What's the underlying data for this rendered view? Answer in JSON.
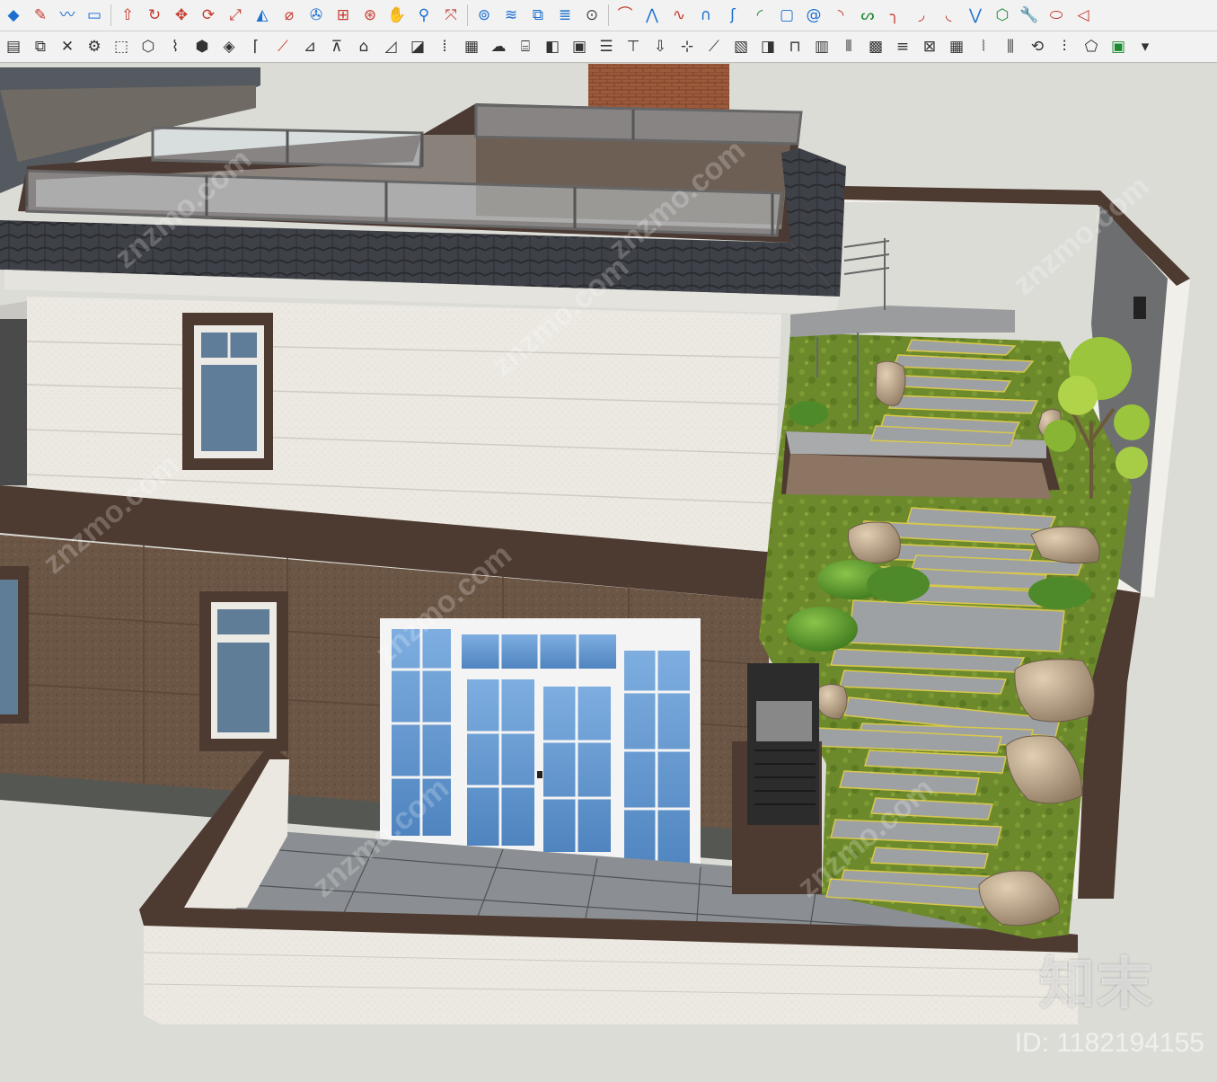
{
  "toolbar_row1": [
    {
      "icon": "eraser-icon",
      "glyph": "◆",
      "color": "#1a6fd1"
    },
    {
      "icon": "pencil-line-icon",
      "glyph": "✎",
      "color": "#c43a2e"
    },
    {
      "icon": "freehand-icon",
      "glyph": "〰",
      "color": "#1a6fd1"
    },
    {
      "icon": "rectangle-icon",
      "glyph": "▭",
      "color": "#1a6fd1"
    },
    {
      "icon": "push-pull-icon",
      "glyph": "⇧",
      "color": "#c43a2e"
    },
    {
      "icon": "follow-me-icon",
      "glyph": "↻",
      "color": "#c43a2e"
    },
    {
      "icon": "move-icon",
      "glyph": "✥",
      "color": "#c43a2e"
    },
    {
      "icon": "rotate-icon",
      "glyph": "⟳",
      "color": "#c43a2e"
    },
    {
      "icon": "scale-icon",
      "glyph": "⤢",
      "color": "#c43a2e"
    },
    {
      "icon": "offset-icon",
      "glyph": "◭",
      "color": "#1a6fd1"
    },
    {
      "icon": "tape-measure-icon",
      "glyph": "⌀",
      "color": "#c43a2e"
    },
    {
      "icon": "paint-bucket-icon",
      "glyph": "✇",
      "color": "#1a6fd1"
    },
    {
      "icon": "section-plane-icon",
      "glyph": "⊞",
      "color": "#c43a2e"
    },
    {
      "icon": "orbit-icon",
      "glyph": "⊛",
      "color": "#c43a2e"
    },
    {
      "icon": "pan-icon",
      "glyph": "✋",
      "color": "#c43a2e"
    },
    {
      "icon": "zoom-icon",
      "glyph": "⚲",
      "color": "#1a6fd1"
    },
    {
      "icon": "zoom-extents-icon",
      "glyph": "⤧",
      "color": "#c43a2e"
    },
    {
      "icon": "warehouse-icon",
      "glyph": "⊚",
      "color": "#1a6fd1"
    },
    {
      "icon": "layers-icon",
      "glyph": "≋",
      "color": "#1a6fd1"
    },
    {
      "icon": "extension-icon",
      "glyph": "⧉",
      "color": "#1a6fd1"
    },
    {
      "icon": "components-icon",
      "glyph": "≣",
      "color": "#1a6fd1"
    },
    {
      "icon": "user-account-icon",
      "glyph": "⊙",
      "color": "#444444"
    },
    {
      "icon": "arc-icon",
      "glyph": "⌒",
      "color": "#c43a2e"
    },
    {
      "icon": "polyline-icon",
      "glyph": "⋀",
      "color": "#1a6fd1"
    },
    {
      "icon": "bezier-icon",
      "glyph": "∿",
      "color": "#c43a2e"
    },
    {
      "icon": "curve-icon",
      "glyph": "∩",
      "color": "#1a6fd1"
    },
    {
      "icon": "spline-icon",
      "glyph": "ʃ",
      "color": "#1a6fd1"
    },
    {
      "icon": "arc-2pt-icon",
      "glyph": "◜",
      "color": "#1a8a2e"
    },
    {
      "icon": "rounded-rect-icon",
      "glyph": "▢",
      "color": "#1a6fd1"
    },
    {
      "icon": "spiral-icon",
      "glyph": "@",
      "color": "#1a6fd1"
    },
    {
      "icon": "arc-3pt-icon",
      "glyph": "◝",
      "color": "#c43a2e"
    },
    {
      "icon": "zigzag-icon",
      "glyph": "ᔕ",
      "color": "#1a8a2e"
    },
    {
      "icon": "fillet-icon",
      "glyph": "╮",
      "color": "#c43a2e"
    },
    {
      "icon": "chamfer-icon",
      "glyph": "◞",
      "color": "#c43a2e"
    },
    {
      "icon": "tangent-arc-icon",
      "glyph": "◟",
      "color": "#c43a2e"
    },
    {
      "icon": "wave-icon",
      "glyph": "⋁",
      "color": "#1a6fd1"
    },
    {
      "icon": "polygon-icon",
      "glyph": "⬡",
      "color": "#1a8a2e"
    },
    {
      "icon": "wrench-icon",
      "glyph": "🔧",
      "color": "#1a8a2e"
    },
    {
      "icon": "ellipse-icon",
      "glyph": "⬭",
      "color": "#c43a2e"
    },
    {
      "icon": "triangle-icon",
      "glyph": "◁",
      "color": "#c43a2e"
    }
  ],
  "toolbar_row2": [
    {
      "icon": "3d-text-icon",
      "glyph": "▤",
      "color": "#333333"
    },
    {
      "icon": "stack-layers-icon",
      "glyph": "⧉",
      "color": "#333333"
    },
    {
      "icon": "intersect-icon",
      "glyph": "✕",
      "color": "#333333"
    },
    {
      "icon": "gear-icon",
      "glyph": "⚙",
      "color": "#333333"
    },
    {
      "icon": "extrude-icon",
      "glyph": "⬚",
      "color": "#333333"
    },
    {
      "icon": "surface-icon",
      "glyph": "⬡",
      "color": "#333333"
    },
    {
      "icon": "pipe-icon",
      "glyph": "⌇",
      "color": "#333333"
    },
    {
      "icon": "box-icon",
      "glyph": "⬢",
      "color": "#333333"
    },
    {
      "icon": "bevel-icon",
      "glyph": "◈",
      "color": "#333333"
    },
    {
      "icon": "corner-icon",
      "glyph": "⌈",
      "color": "#333333"
    },
    {
      "icon": "trim-icon",
      "glyph": "⟋",
      "color": "#c43a2e"
    },
    {
      "icon": "slice-icon",
      "glyph": "⊿",
      "color": "#333333"
    },
    {
      "icon": "loft-icon",
      "glyph": "⊼",
      "color": "#333333"
    },
    {
      "icon": "roof-icon",
      "glyph": "⌂",
      "color": "#333333"
    },
    {
      "icon": "ramp-icon",
      "glyph": "◿",
      "color": "#333333"
    },
    {
      "icon": "fill-icon",
      "glyph": "◪",
      "color": "#333333"
    },
    {
      "icon": "array-icon",
      "glyph": "⦙",
      "color": "#333333"
    },
    {
      "icon": "grid-array-icon",
      "glyph": "▦",
      "color": "#333333"
    },
    {
      "icon": "cloud-icon",
      "glyph": "☁",
      "color": "#333333"
    },
    {
      "icon": "stairs-icon",
      "glyph": "⌸",
      "color": "#333333"
    },
    {
      "icon": "sheet-icon",
      "glyph": "◧",
      "color": "#333333"
    },
    {
      "icon": "frame-icon",
      "glyph": "▣",
      "color": "#333333"
    },
    {
      "icon": "shelf-icon",
      "glyph": "☰",
      "color": "#333333"
    },
    {
      "icon": "column-icon",
      "glyph": "⊤",
      "color": "#333333"
    },
    {
      "icon": "arrow-down-icon",
      "glyph": "⇩",
      "color": "#333333"
    },
    {
      "icon": "axis-icon",
      "glyph": "⊹",
      "color": "#333333"
    },
    {
      "icon": "diagonal-icon",
      "glyph": "⟋",
      "color": "#333333"
    },
    {
      "icon": "hatch-icon",
      "glyph": "▧",
      "color": "#333333"
    },
    {
      "icon": "panel-icon",
      "glyph": "◨",
      "color": "#333333"
    },
    {
      "icon": "door-icon",
      "glyph": "⊓",
      "color": "#333333"
    },
    {
      "icon": "wall-icon",
      "glyph": "▥",
      "color": "#333333"
    },
    {
      "icon": "slats-icon",
      "glyph": "⦀",
      "color": "#333333"
    },
    {
      "icon": "texture-icon",
      "glyph": "▩",
      "color": "#333333"
    },
    {
      "icon": "stripes-icon",
      "glyph": "≡",
      "color": "#333333"
    },
    {
      "icon": "lattice-icon",
      "glyph": "⊠",
      "color": "#333333"
    },
    {
      "icon": "tiles-icon",
      "glyph": "▦",
      "color": "#333333"
    },
    {
      "icon": "planks-icon",
      "glyph": "⦚",
      "color": "#333333"
    },
    {
      "icon": "louver-icon",
      "glyph": "⫼",
      "color": "#333333"
    },
    {
      "icon": "rotate-surface-icon",
      "glyph": "⟲",
      "color": "#333333"
    },
    {
      "icon": "comb-icon",
      "glyph": "⫶",
      "color": "#333333"
    },
    {
      "icon": "cube-icon",
      "glyph": "⬠",
      "color": "#333333"
    },
    {
      "icon": "green-box-icon",
      "glyph": "▣",
      "color": "#1a8a2e"
    },
    {
      "icon": "dropdown-arrow-icon",
      "glyph": "▾",
      "color": "#333333"
    }
  ],
  "watermark": {
    "logo": "知末",
    "id_text": "ID: 1182194155",
    "repeated": "znzmo.com"
  },
  "colors": {
    "sky": "#dcdcd7",
    "wall_white": "#eeebe4",
    "wall_brown": "#6e5847",
    "trim_dark": "#4d3a30",
    "roof_tile": "#3c3f44",
    "glass": "#6fa2d6",
    "lawn": "#6f8a2c",
    "stone_step": "#9ea1a4",
    "paving": "#8d9195",
    "chimney": "#9a5a3a"
  }
}
